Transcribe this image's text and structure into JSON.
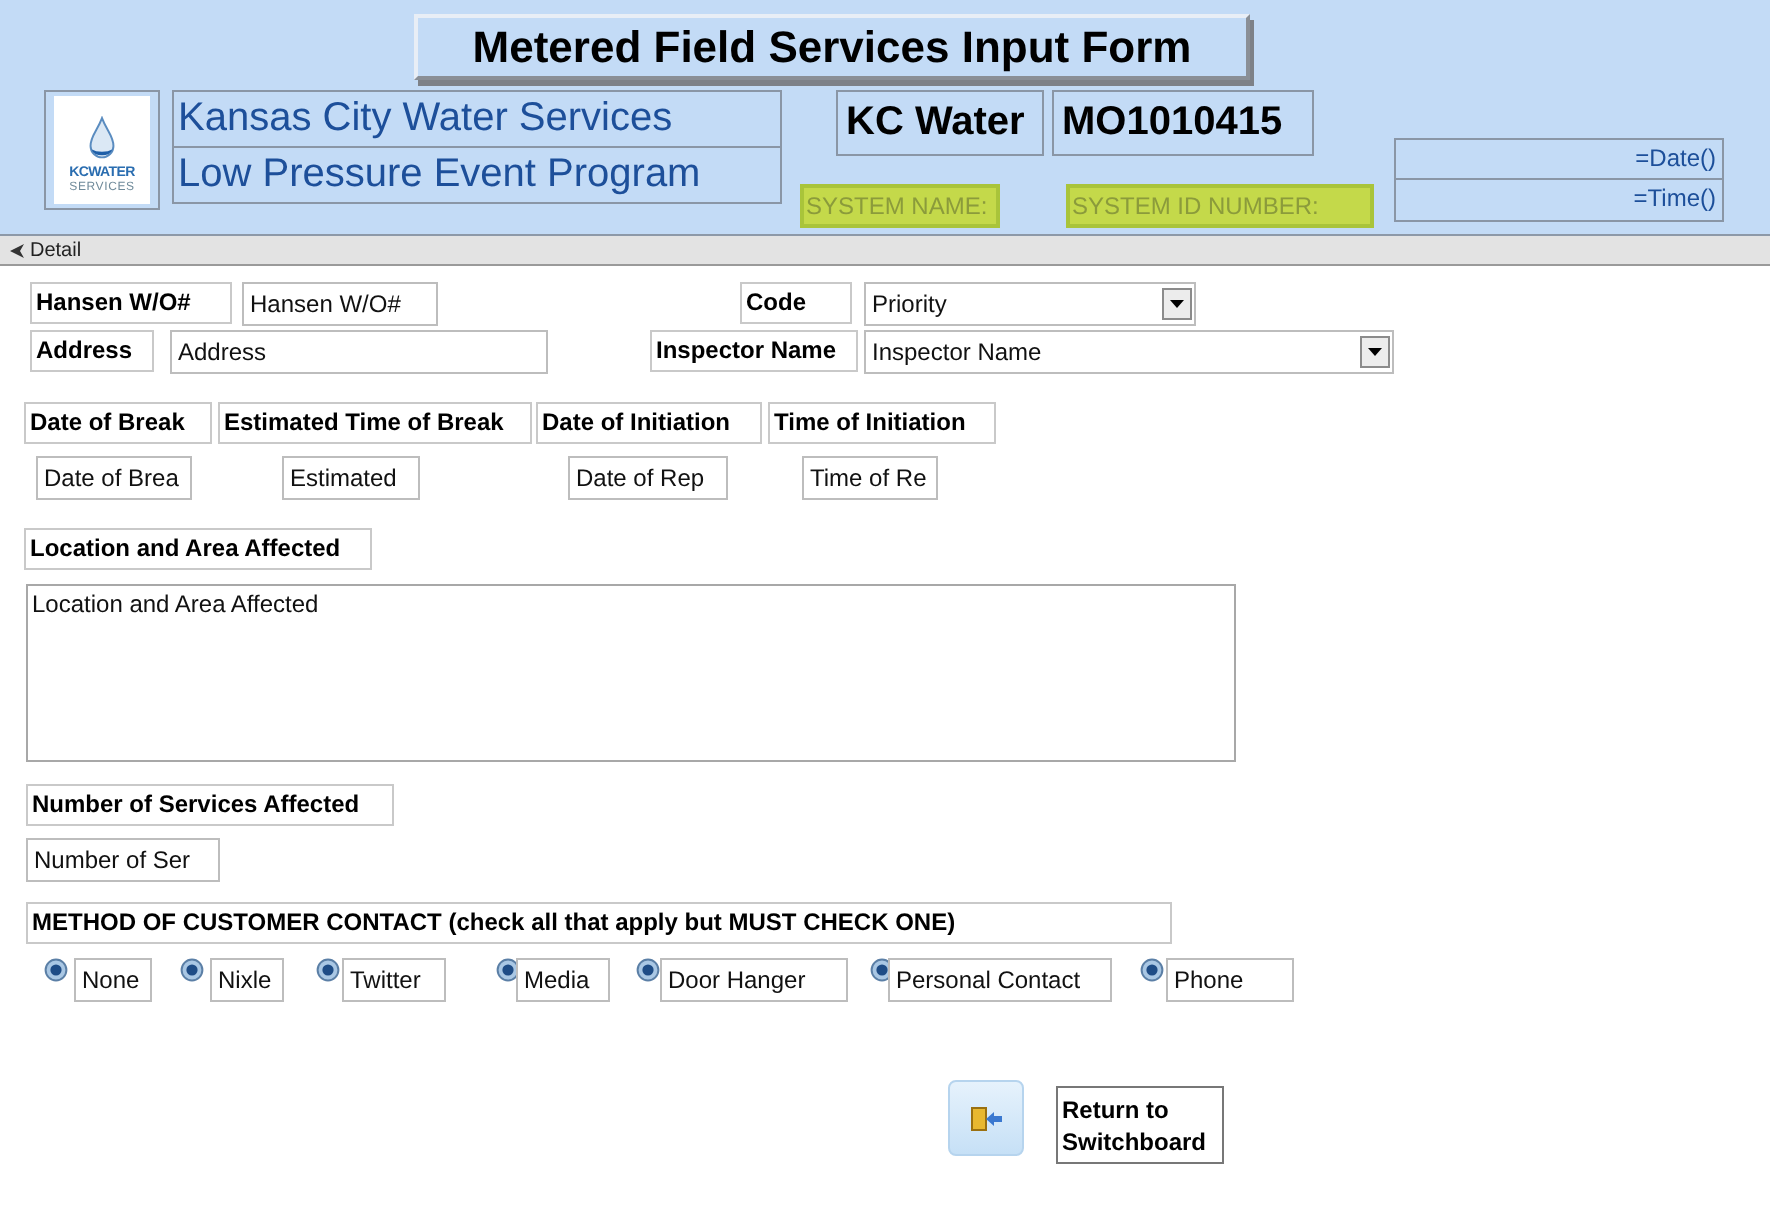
{
  "header": {
    "title": "Metered Field Services Input Form",
    "logo_text": "KCWATER",
    "logo_subtext": "SERVICES",
    "org_lines": [
      "Kansas City Water Services",
      "Low Pressure Event Program"
    ],
    "system_name": "KC Water",
    "system_id": "MO1010415",
    "system_name_label": "SYSTEM NAME:",
    "system_id_label": "SYSTEM ID NUMBER:",
    "date_expr": "=Date()",
    "time_expr": "=Time()"
  },
  "section": {
    "title": "Detail"
  },
  "top_fields": [
    {
      "label": "Hansen W/O#",
      "value": "Hansen W/O#",
      "kind": "text"
    },
    {
      "label": "Code",
      "value": "Priority",
      "kind": "combo"
    },
    {
      "label": "Address",
      "value": "Address",
      "kind": "text"
    },
    {
      "label": "Inspector Name",
      "value": "Inspector Name",
      "kind": "combo"
    }
  ],
  "time_fields": [
    {
      "label": "Date of Break",
      "value": "Date of Brea"
    },
    {
      "label": "Estimated Time of Break",
      "value": "Estimated"
    },
    {
      "label": "Date of Initiation",
      "value": "Date of Rep"
    },
    {
      "label": "Time of Initiation",
      "value": "Time of Re"
    }
  ],
  "location": {
    "label": "Location and Area Affected",
    "value": "Location and Area Affected"
  },
  "services": {
    "label": "Number of Services Affected",
    "value": "Number of Ser"
  },
  "contact": {
    "label": "METHOD OF CUSTOMER CONTACT (check all that apply but MUST CHECK ONE)",
    "options": [
      {
        "label": "None",
        "checked": true
      },
      {
        "label": "Nixle",
        "checked": true
      },
      {
        "label": "Twitter",
        "checked": true
      },
      {
        "label": "Media",
        "checked": true
      },
      {
        "label": "Door Hanger",
        "checked": true
      },
      {
        "label": "Personal Contact",
        "checked": true
      },
      {
        "label": "Phone",
        "checked": true
      }
    ]
  },
  "return_button": {
    "label": "Return to Switchboard"
  }
}
